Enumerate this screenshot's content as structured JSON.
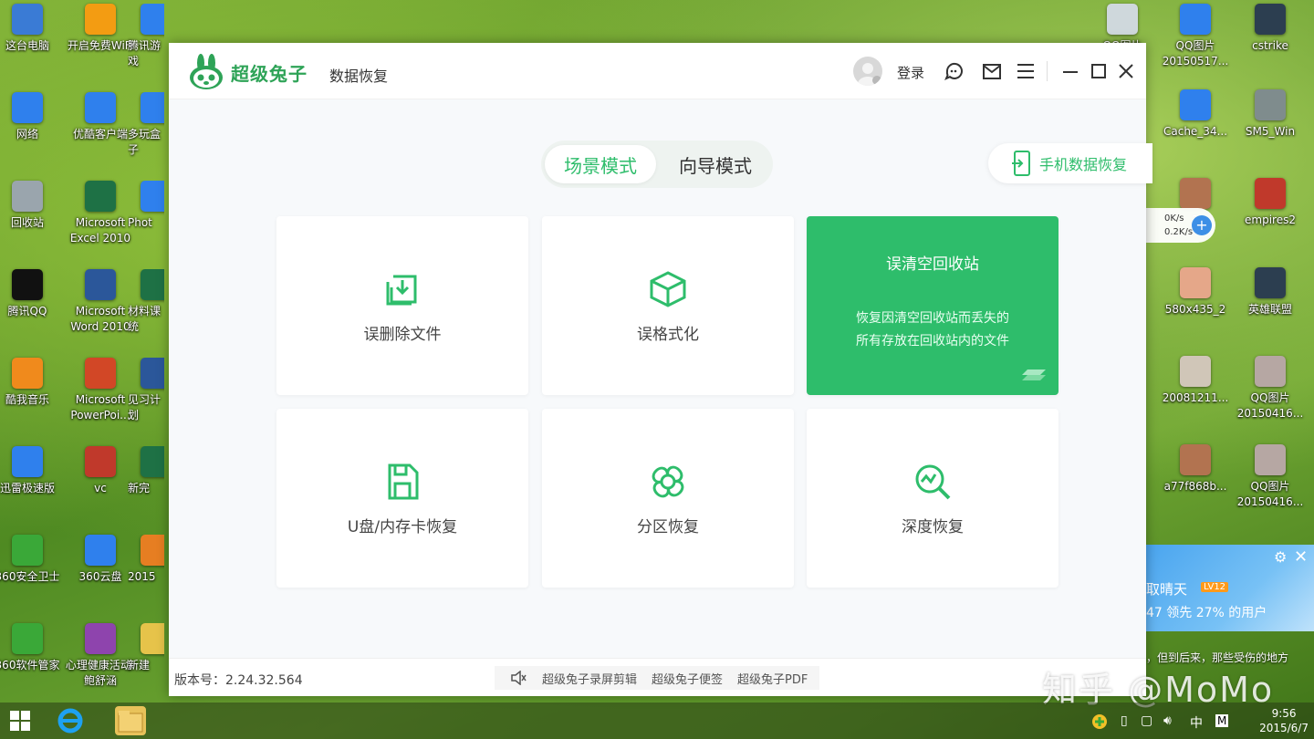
{
  "desktop_left": [
    {
      "label": "这台电脑",
      "color": "#3a7bd5"
    },
    {
      "label": "开启免费WiFi",
      "color": "#f39c12"
    },
    {
      "label": "腾讯游戏",
      "color": "#2f80ed"
    },
    {
      "label": "网络",
      "color": "#2f80ed"
    },
    {
      "label": "优酷客户端",
      "color": "#2f80ed"
    },
    {
      "label": "多玩盒子",
      "color": "#2f80ed"
    },
    {
      "label": "回收站",
      "color": "#9aa5ad"
    },
    {
      "label": "Microsoft Excel 2010",
      "color": "#1e7145"
    },
    {
      "label": "Phot",
      "color": "#2f80ed"
    },
    {
      "label": "腾讯QQ",
      "color": "#111111"
    },
    {
      "label": "Microsoft Word 2010",
      "color": "#2b579a"
    },
    {
      "label": "材料课统",
      "color": "#1e7145"
    },
    {
      "label": "酷我音乐",
      "color": "#f08a1c"
    },
    {
      "label": "Microsoft PowerPoi...",
      "color": "#d24726"
    },
    {
      "label": "见习计划",
      "color": "#2b579a"
    },
    {
      "label": "迅雷极速版",
      "color": "#2f80ed"
    },
    {
      "label": "vc",
      "color": "#c0392b"
    },
    {
      "label": "新完",
      "color": "#1e7145"
    },
    {
      "label": "360安全卫士",
      "color": "#3aa838"
    },
    {
      "label": "360云盘",
      "color": "#2f80ed"
    },
    {
      "label": "2015",
      "color": "#e67e22"
    },
    {
      "label": "360软件管家",
      "color": "#3aa838"
    },
    {
      "label": "心理健康活动-鲍舒涵",
      "color": "#8e44ad"
    },
    {
      "label": "新建",
      "color": "#e6c34a"
    }
  ],
  "desktop_right": [
    {
      "label": "QQ图片",
      "color": "#cfd8dc"
    },
    {
      "label": "QQ图片20150517...",
      "color": "#2f80ed"
    },
    {
      "label": "cstrike",
      "color": "#2c3e50"
    },
    {
      "label": "Cache_34...",
      "color": "#2f80ed"
    },
    {
      "label": "SM5_Win",
      "color": "#7f8c8d"
    },
    {
      "label": "2",
      "color": "#b27350"
    },
    {
      "label": "empires2",
      "color": "#c0392b"
    },
    {
      "label": "580x435_2",
      "color": "#e5a789"
    },
    {
      "label": "英雄联盟",
      "color": "#2c3e50"
    },
    {
      "label": "20081211...",
      "color": "#d0c6b8"
    },
    {
      "label": "QQ图片20150416...",
      "color": "#b6a7a3"
    },
    {
      "label": "a77f868b...",
      "color": "#b27350"
    },
    {
      "label": "QQ图片20150416...",
      "color": "#b6a7a3"
    }
  ],
  "app": {
    "brand": "超级兔子",
    "brand_sub": "数据恢复",
    "login": "登录",
    "modes": {
      "scene": "场景模式",
      "wizard": "向导模式"
    },
    "mobile_recovery": "手机数据恢复",
    "cards": [
      {
        "label": "误删除文件",
        "icon": "file-restore-icon"
      },
      {
        "label": "误格式化",
        "icon": "cube-icon"
      },
      {
        "title": "误清空回收站",
        "desc_line1": "恢复因清空回收站而丢失的",
        "desc_line2": "所有存放在回收站内的文件",
        "active": true
      },
      {
        "label": "U盘/内存卡恢复",
        "icon": "sd-card-icon"
      },
      {
        "label": "分区恢复",
        "icon": "partition-icon"
      },
      {
        "label": "深度恢复",
        "icon": "search-chart-icon"
      }
    ],
    "version": "版本号：2.24.32.564",
    "footer_links": [
      "超级兔子录屏剪辑",
      "超级兔子便签",
      "超级兔子PDF"
    ],
    "accent": "#2ebd6b"
  },
  "speed": {
    "up": "0K/s",
    "down": "0.2K/s"
  },
  "popup": {
    "name": "取晴天",
    "level": "LV12",
    "text": "47   领先 27% 的用户",
    "note": "，但到后来，那些受伤的地方"
  },
  "watermark": "知乎 @MoMo",
  "clock": {
    "time": "9:56",
    "date": "2015/6/7"
  },
  "tray_ime": "中"
}
